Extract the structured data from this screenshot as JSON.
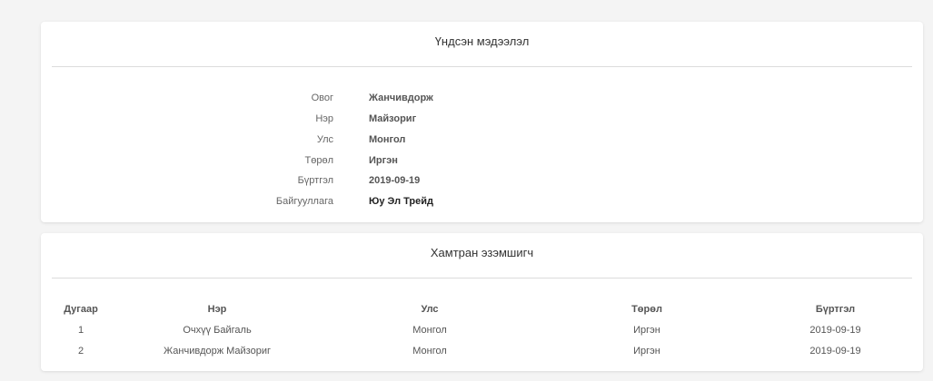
{
  "basic": {
    "title": "Үндсэн мэдээлэл",
    "rows": [
      {
        "label": "Овог",
        "value": "Жанчивдорж"
      },
      {
        "label": "Нэр",
        "value": "Майзориг"
      },
      {
        "label": "Улс",
        "value": "Монгол"
      },
      {
        "label": "Төрөл",
        "value": "Иргэн"
      },
      {
        "label": "Бүртгэл",
        "value": "2019-09-19"
      },
      {
        "label": "Байгууллага",
        "value": "Юу Эл Трейд"
      }
    ]
  },
  "owners": {
    "title": "Хамтран эзэмшигч",
    "columns": [
      "Дугаар",
      "Нэр",
      "Улс",
      "Төрөл",
      "Бүртгэл"
    ],
    "rows": [
      [
        "1",
        "Очхүү Байгаль",
        "Монгол",
        "Иргэн",
        "2019-09-19"
      ],
      [
        "2",
        "Жанчивдорж Майзориг",
        "Монгол",
        "Иргэн",
        "2019-09-19"
      ]
    ]
  }
}
